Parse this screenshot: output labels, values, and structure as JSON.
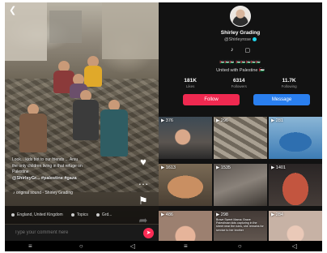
{
  "left_screen": {
    "back_icon": "chevron-left-icon",
    "side_actions": [
      "heart-icon",
      "comment-icon",
      "bookmark-icon",
      "share-icon"
    ],
    "caption_lines": [
      "Look... kids bot to our friends ... Arsu",
      "the only children living in that refuge on",
      "Palestine"
    ],
    "hashtags": "@ShirleyGr... #palestine #gaza",
    "sound": "♪ original sound - Shirley Grading",
    "location_tag": "England, United Kingdom",
    "topics_tag": "Topics",
    "tag_3": "Grd...",
    "comment_placeholder": "Type your comment here",
    "send_icon": "send-arrow-icon",
    "nav_icons": [
      "menu-icon",
      "home-circle-icon",
      "back-triangle-icon"
    ]
  },
  "profile": {
    "name": "Shirley Grading",
    "handle": "@Shirleyrose",
    "social_icons": [
      "tiktok-icon",
      "instagram-icon"
    ],
    "flags_line": "🇵🇸🇵🇸🇵🇸 🇵🇸🇵🇸🇵🇸🇵🇸🇵🇸",
    "bio": "United with Palestine 🇵🇸",
    "stats": [
      {
        "value": "181K",
        "label": "Likes"
      },
      {
        "value": "6314",
        "label": "Followers"
      },
      {
        "value": "11.7K",
        "label": "Following"
      }
    ],
    "follow_label": "Follow",
    "message_label": "Message"
  },
  "videos": [
    {
      "views": "▶ 376",
      "caption": ""
    },
    {
      "views": "▶ 296",
      "caption": ""
    },
    {
      "views": "▶ 281",
      "caption": ""
    },
    {
      "views": "▶ 1613",
      "caption": ""
    },
    {
      "views": "▶ 1535",
      "caption": ""
    },
    {
      "views": "▶ 1401",
      "caption": ""
    },
    {
      "views": "▶ 486",
      "caption": ""
    },
    {
      "views": "▶ 298",
      "caption": "Brave Sweet Mama: Brave Palestinian kids capturing in the street near the ruins, she remains for service to her brother"
    },
    {
      "views": "▶ 284",
      "caption": ""
    }
  ],
  "right_nav_icons": [
    "menu-icon",
    "home-circle-icon",
    "back-triangle-icon"
  ]
}
